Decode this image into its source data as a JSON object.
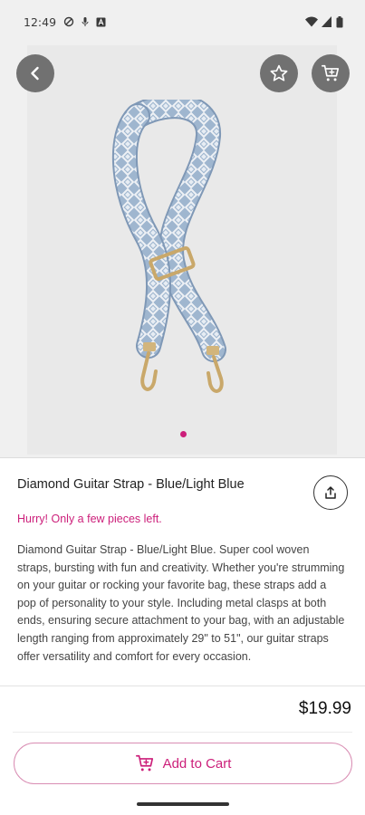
{
  "status_bar": {
    "time": "12:49",
    "left_icons": [
      "no-disturb-icon",
      "mic-icon",
      "a-box-icon"
    ],
    "right_icons": [
      "wifi-icon",
      "signal-icon",
      "battery-icon"
    ]
  },
  "toolbar": {
    "back_icon": "arrow-left-icon",
    "favorite_icon": "star-icon",
    "cart_icon": "cart-icon"
  },
  "gallery": {
    "image_subject": "woven blue and light-blue guitar strap with gold clasps",
    "current_page": 1,
    "page_count": 1
  },
  "product": {
    "title": "Diamond Guitar Strap - Blue/Light Blue",
    "stock_note": "Hurry! Only a few pieces left.",
    "description": "Diamond Guitar Strap - Blue/Light Blue. Super cool woven straps, bursting with fun and creativity. Whether you're strumming on your guitar or rocking your favorite bag, these straps add a pop of personality to your style. Including metal clasps at both ends, ensuring secure attachment to your bag, with an adjustable length ranging from approximately 29\" to 51\", our guitar straps offer versatility and comfort for every occasion.",
    "price": "$19.99",
    "share_icon": "share-icon"
  },
  "cart_button": {
    "label": "Add to Cart",
    "icon": "cart-icon"
  },
  "colors": {
    "accent": "#cc1f7a",
    "button_border": "#d98db3",
    "overlay_button": "#717171"
  }
}
